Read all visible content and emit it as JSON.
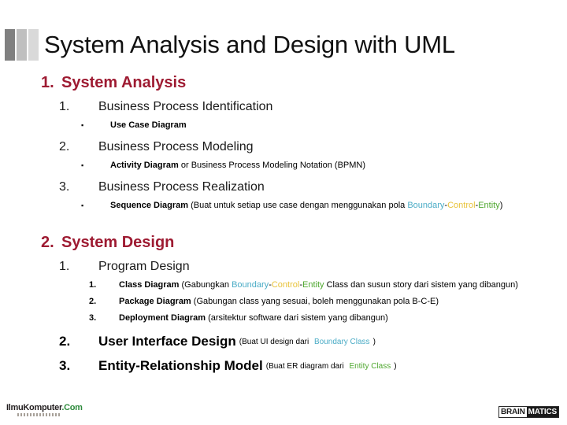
{
  "slide": {
    "title": "System Analysis and Design with UML"
  },
  "sections": [
    {
      "number": "1.",
      "title": "System Analysis",
      "items": [
        {
          "number": "1.",
          "label": "Business Process Identification",
          "sub": [
            {
              "bullet": "▪",
              "lead": "Use Case Diagram",
              "rest": ""
            }
          ]
        },
        {
          "number": "2.",
          "label": "Business Process Modeling",
          "sub": [
            {
              "bullet": "▪",
              "lead": "Activity Diagram",
              "rest": " or Business Process Modeling Notation (BPMN)"
            }
          ]
        },
        {
          "number": "3.",
          "label": "Business Process Realization",
          "sub": [
            {
              "bullet": "▪",
              "lead": "Sequence Diagram",
              "note_pre": "(Buat untuk setiap use case dengan menggunakan pola ",
              "boundary": "Boundary",
              "sep1": "-",
              "control": "Control",
              "sep2": "-",
              "entity": "Entity",
              "note_post": ")"
            }
          ]
        }
      ]
    },
    {
      "number": "2.",
      "title": "System Design",
      "items": [
        {
          "number": "1.",
          "label": "Program Design",
          "numbered_sub": [
            {
              "number": "1.",
              "lead": "Class Diagram",
              "note_pre": " (Gabungkan ",
              "boundary": "Boundary",
              "sep1": "-",
              "control": "Control",
              "sep2": "-",
              "entity": "Entity",
              "note_post": " Class dan susun story dari sistem yang dibangun)"
            },
            {
              "number": "2.",
              "lead": "Package Diagram",
              "note_pre": " (Gabungan class yang sesuai, boleh menggunakan pola B-C-E)"
            },
            {
              "number": "3.",
              "lead": "Deployment Diagram",
              "note_pre": "  (arsitektur software dari sistem yang dibangun)"
            }
          ]
        }
      ],
      "big_items": [
        {
          "number": "2.",
          "lead": "User Interface Design",
          "note_pre": "(Buat UI design dari ",
          "colored": "Boundary Class",
          "color_class": "boundary",
          "note_post": ")"
        },
        {
          "number": "3.",
          "lead": "Entity-Relationship Model",
          "note_pre": "(Buat ER diagram dari ",
          "colored": "Entity Class",
          "color_class": "entity",
          "note_post": ")"
        }
      ]
    }
  ],
  "footer": {
    "left_logo_dark": "IlmuKomputer",
    "left_logo_green": ".Com",
    "right_logo_a": "BRAIN",
    "right_logo_b": "MATICS"
  },
  "colors": {
    "heading_red": "#9E1B32",
    "boundary": "#4BACC6",
    "control": "#E8C33B",
    "entity": "#4EA72E"
  }
}
